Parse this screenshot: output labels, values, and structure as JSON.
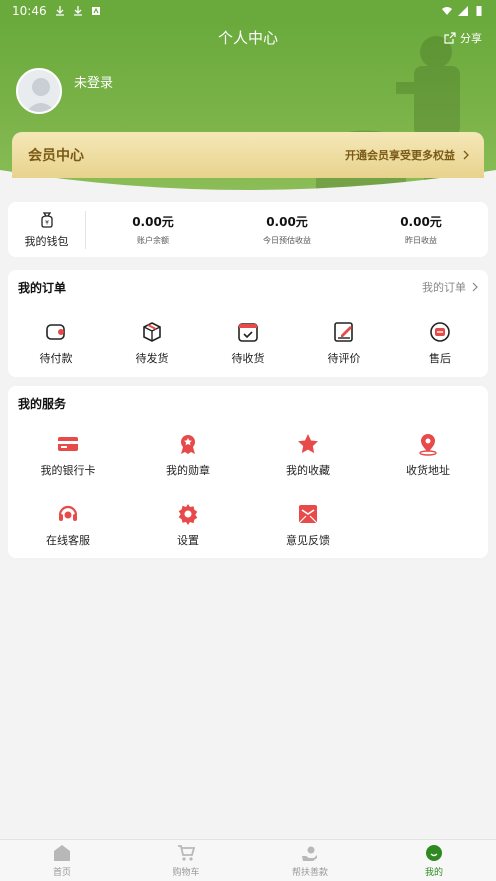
{
  "status_bar": {
    "time": "10:46"
  },
  "header": {
    "title": "个人中心",
    "share_label": "分享",
    "username": "未登录"
  },
  "member": {
    "title": "会员中心",
    "hint": "开通会员享受更多权益"
  },
  "wallet": {
    "label": "我的钱包",
    "stats": [
      {
        "value": "0.00元",
        "label": "账户余额"
      },
      {
        "value": "0.00元",
        "label": "今日预估收益"
      },
      {
        "value": "0.00元",
        "label": "昨日收益"
      }
    ]
  },
  "orders": {
    "title": "我的订单",
    "more": "我的订单",
    "items": [
      {
        "label": "待付款",
        "icon": "wallet-icon"
      },
      {
        "label": "待发货",
        "icon": "box-icon"
      },
      {
        "label": "待收货",
        "icon": "calendar-check-icon"
      },
      {
        "label": "待评价",
        "icon": "edit-icon"
      },
      {
        "label": "售后",
        "icon": "after-sale-icon"
      }
    ]
  },
  "services": {
    "title": "我的服务",
    "items": [
      {
        "label": "我的银行卡",
        "icon": "bank-card-icon"
      },
      {
        "label": "我的勋章",
        "icon": "medal-icon"
      },
      {
        "label": "我的收藏",
        "icon": "star-icon"
      },
      {
        "label": "收货地址",
        "icon": "location-icon"
      },
      {
        "label": "在线客服",
        "icon": "headset-icon"
      },
      {
        "label": "设置",
        "icon": "gear-icon"
      },
      {
        "label": "意见反馈",
        "icon": "mail-icon"
      }
    ]
  },
  "tabbar": {
    "items": [
      {
        "label": "首页",
        "icon": "home-icon"
      },
      {
        "label": "购物车",
        "icon": "cart-icon"
      },
      {
        "label": "帮扶善款",
        "icon": "donate-icon"
      },
      {
        "label": "我的",
        "icon": "profile-icon",
        "active": true
      }
    ]
  },
  "colors": {
    "accent_green": "#6aaa3c",
    "icon_red": "#e84a4a",
    "active_tab": "#2e8a20",
    "member_gold": "#e8d38d"
  }
}
